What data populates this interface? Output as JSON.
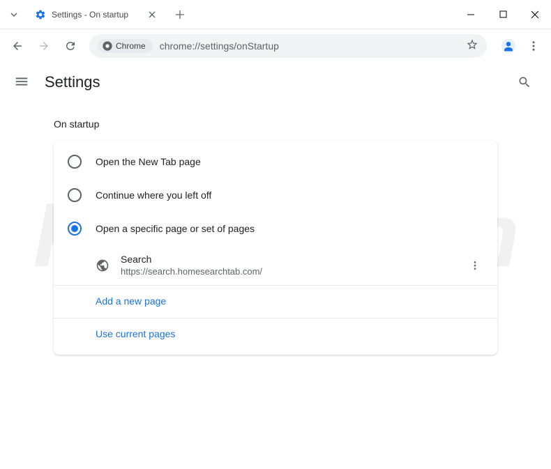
{
  "tab": {
    "title": "Settings - On startup"
  },
  "omnibox": {
    "chip": "Chrome",
    "url": "chrome://settings/onStartup"
  },
  "header": {
    "title": "Settings"
  },
  "section": {
    "title": "On startup"
  },
  "radio_options": {
    "new_tab": "Open the New Tab page",
    "continue": "Continue where you left off",
    "specific": "Open a specific page or set of pages"
  },
  "pages": [
    {
      "name": "Search",
      "url": "https://search.homesearchtab.com/"
    }
  ],
  "links": {
    "add_page": "Add a new page",
    "use_current": "Use current pages"
  },
  "watermark": "PCrisk.com"
}
